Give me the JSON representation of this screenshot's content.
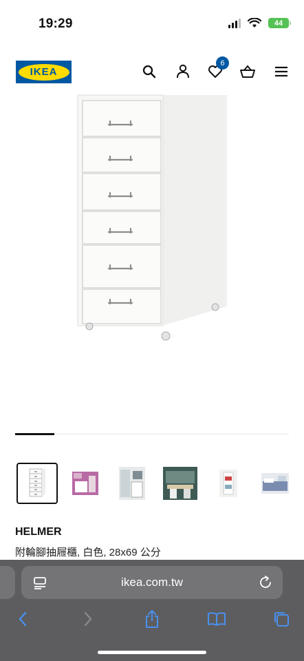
{
  "status": {
    "time": "19:29",
    "battery": "44"
  },
  "header": {
    "logo_text": "IKEA",
    "wishlist_count": "6",
    "icons": [
      "search-icon",
      "account-icon",
      "heart-icon",
      "basket-icon",
      "menu-icon"
    ]
  },
  "carousel": {
    "active_index": 0,
    "total": 7
  },
  "thumbnails": [
    {
      "name": "thumb-drawer-unit-white"
    },
    {
      "name": "thumb-pink-office"
    },
    {
      "name": "thumb-storage-room"
    },
    {
      "name": "thumb-green-workspace"
    },
    {
      "name": "thumb-drawer-closeup"
    },
    {
      "name": "thumb-bedroom"
    }
  ],
  "product": {
    "name": "HELMER",
    "description": "附輪腳抽屜櫃, 白色, 28x69 公分"
  },
  "browser": {
    "url": "ikea.com.tw"
  },
  "colors": {
    "ikea_blue": "#0058a3",
    "ikea_yellow": "#ffdb00",
    "toolbar_blue": "#4a90f0"
  }
}
